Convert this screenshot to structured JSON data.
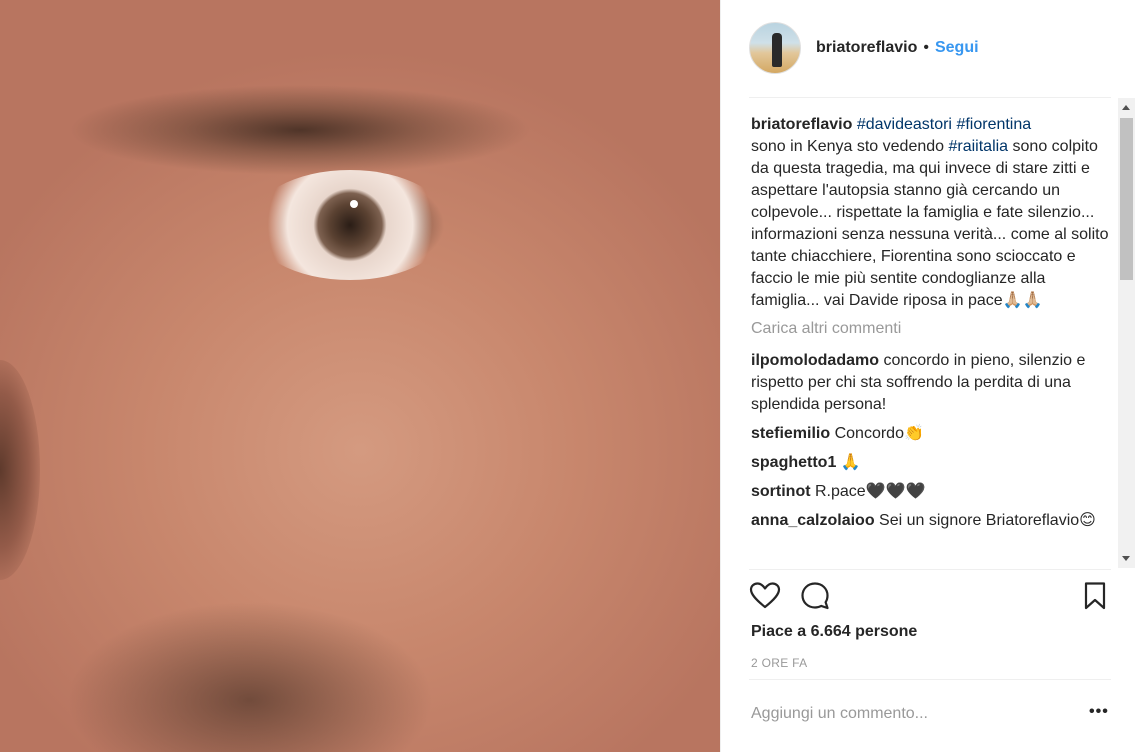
{
  "post": {
    "author": "briatoreflavio",
    "separator": "•",
    "follow_label": "Segui",
    "caption": {
      "username": "briatoreflavio",
      "tag1": "#davideastori",
      "tag2": "#fiorentina",
      "text1": "sono in Kenya sto vedendo ",
      "tag3": "#raiitalia",
      "text2": " sono colpito da questa tragedia, ma qui invece di stare zitti e aspettare l'autopsia stanno già cercando un colpevole... rispettate la famiglia e fate silenzio... informazioni senza nessuna verità... come al solito tante chiacchiere, Fiorentina sono scioccato e faccio le mie più sentite condoglianze alla famiglia... vai Davide riposa in pace🙏🏼🙏🏼"
    },
    "load_more_label": "Carica altri commenti",
    "comments": [
      {
        "username": "ilpomolodadamo",
        "text": "concordo in pieno, silenzio e rispetto per chi sta soffrendo la perdita di una splendida persona!"
      },
      {
        "username": "stefiemilio",
        "text": "Concordo👏"
      },
      {
        "username": "spaghetto1",
        "text": "🙏"
      },
      {
        "username": "sortinot",
        "text": "R.pace🖤🖤🖤"
      },
      {
        "username": "anna_calzolaioo",
        "text": "Sei un signore Briatoreflavio😊"
      }
    ],
    "likes_label": "Piace a 6.664 persone",
    "time_label": "2 ORE FA",
    "add_comment_placeholder": "Aggiungi un commento...",
    "more_label": "•••"
  },
  "icons": {
    "like": "heart-icon",
    "comment": "comment-bubble-icon",
    "bookmark": "bookmark-icon"
  },
  "colors": {
    "link_blue": "#3897f0",
    "hashtag": "#003569",
    "muted": "#999999",
    "text": "#262626"
  }
}
